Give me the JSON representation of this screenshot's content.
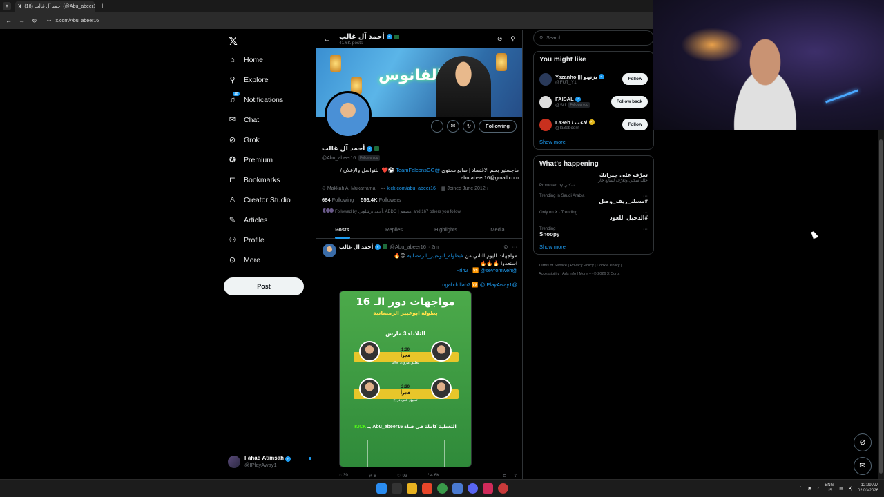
{
  "browser": {
    "tab_title": "أحمد آل غالب (@Abu_abeer16) / X",
    "tab_title_display": "(18) أحمد آل غالب (@Abu_abeer16",
    "url": "x.com/Abu_abeer16"
  },
  "nav": {
    "items": [
      {
        "label": "Home",
        "icon": "home-icon"
      },
      {
        "label": "Explore",
        "icon": "search-icon"
      },
      {
        "label": "Notifications",
        "icon": "bell-icon",
        "badge": "18"
      },
      {
        "label": "Chat",
        "icon": "mail-icon"
      },
      {
        "label": "Grok",
        "icon": "grok-icon"
      },
      {
        "label": "Premium",
        "icon": "premium-icon"
      },
      {
        "label": "Bookmarks",
        "icon": "bookmark-icon"
      },
      {
        "label": "Creator Studio",
        "icon": "creator-icon"
      },
      {
        "label": "Articles",
        "icon": "articles-icon"
      },
      {
        "label": "Profile",
        "icon": "person-icon"
      },
      {
        "label": "More",
        "icon": "more-icon"
      }
    ],
    "post_label": "Post",
    "me_name": "Fahad Atimsah",
    "me_handle": "@IPlayAway1"
  },
  "profile": {
    "header_name": "أحمد آل غالب",
    "header_posts": "41.6K posts",
    "banner_text": "الفانوس",
    "name": "أحمد آل غالب",
    "handle": "@Abu_abeer16",
    "follows_you": "Follows you",
    "following_label": "Following",
    "bio_line1": "ماجستير بعلم الاقتصاد | صانع محتوى",
    "bio_link1": "@TeamFalconsGG",
    "bio_line2": "| للتواصل والإعلان /",
    "bio_email": "abu.abeer16@gmail.com",
    "location": "Makkah Al Mukarrama",
    "website": "kick.com/abu_abeer16",
    "joined": "Joined June 2012",
    "following_count": "684",
    "following_text": "Following",
    "followers_count": "556.4K",
    "followers_text": "Followers",
    "followed_by": "Followed by أحمد برشلوني, ABDO | مصمم, and 167 others you follow",
    "tabs": [
      "Posts",
      "Replies",
      "Highlights",
      "Media"
    ]
  },
  "tweet": {
    "name": "أحمد آل غالب",
    "handle": "@Abu_abeer16",
    "time": "· 2m",
    "text_line1": "مواجهات اليوم الثاني من",
    "hashtag": "#بطولة_ابوعبير_الرمضانية",
    "text_line2": "استعدوا 🔥🔥🔥",
    "mention1": "@Fri42_",
    "mention2": "@sevromweh",
    "mention3": "@ogabdullah7",
    "mention4": "@IPlayAway1",
    "media": {
      "title": "مواجهات دور الـ 16",
      "subtitle": "بطولة ابوعبير الرمضانية",
      "date": "الثلاثاء 3 مارس",
      "match1_time": "1:30",
      "match1_label": "فجراً",
      "match1_comm": "تعليق مروان خالد",
      "match2_time": "2:30",
      "match2_label": "فجراً",
      "match2_comm": "تعليق علي دراج",
      "footer": "التغطية كاملة في قناة Abu_abeer16 بـ",
      "footer_kick": "KICK"
    },
    "replies": "39",
    "reposts": "8",
    "likes": "93",
    "views": "4.6K"
  },
  "sidebar": {
    "search_placeholder": "Search",
    "might_like_title": "You might like",
    "suggestions": [
      {
        "name": "Yazanho ||| يزنهو",
        "handle": "@FUT_Y1",
        "button": "Follow",
        "follows_you": ""
      },
      {
        "name": "FAISAL",
        "handle": "@Sf1",
        "button": "Follow back",
        "follows_you": "Follows you"
      },
      {
        "name": "La3eb / لاعب",
        "handle": "@la3ebcom",
        "button": "Follow",
        "follows_you": ""
      }
    ],
    "show_more": "Show more",
    "happening_title": "What's happening",
    "trends": [
      {
        "meta": "",
        "title": "تعرّف على جيرانك",
        "desc": "خلك سكني وتعرّف لسابع جار",
        "promo": "Promoted by سكني"
      },
      {
        "meta": "Trending in Saudi Arabia",
        "title": "#مسك_ريف_وصل",
        "desc": "",
        "promo": ""
      },
      {
        "meta": "Only on X · Trending",
        "title": "#الدحيل_للعود",
        "desc": "",
        "promo": ""
      },
      {
        "meta": "Trending",
        "title": "Snoopy",
        "desc": "",
        "promo": ""
      }
    ],
    "show_more_2": "Show more",
    "footer": [
      "Terms of Service",
      "Privacy Policy",
      "Cookie Policy",
      "Accessibility",
      "Ads info",
      "More ···",
      "© 2026 X Corp."
    ]
  },
  "taskbar": {
    "lang_top": "ENG",
    "lang_bottom": "US",
    "time": "12:29 AM",
    "date": "02/03/2026"
  },
  "colors": {
    "accent": "#1d9bf0",
    "background": "#000000",
    "border": "#2f3336",
    "muted": "#71767b"
  }
}
